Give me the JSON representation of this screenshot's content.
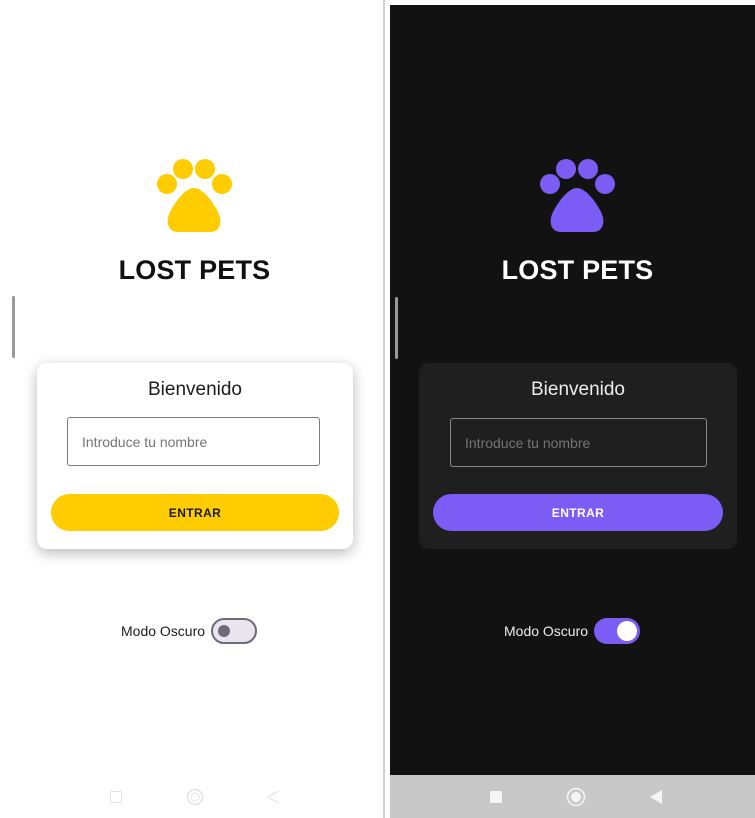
{
  "app": {
    "title": "LOST PETS"
  },
  "login_card": {
    "heading": "Bienvenido",
    "name_input": {
      "value": "",
      "placeholder": "Introduce tu nombre"
    },
    "enter_label": "ENTRAR"
  },
  "dark_mode": {
    "label": "Modo Oscuro"
  },
  "light_screen": {
    "dark_mode_on": false
  },
  "dark_screen": {
    "dark_mode_on": true
  },
  "icons": {
    "logo": "paw-icon",
    "nav_recents": "square-icon",
    "nav_home": "circle-icon",
    "nav_back": "triangle-back-icon"
  },
  "colors": {
    "light_accent": "#ffcc00",
    "dark_accent": "#7b5cf5",
    "light_bg": "#ffffff",
    "dark_bg": "#121212",
    "dark_card": "#1f1f1f"
  }
}
